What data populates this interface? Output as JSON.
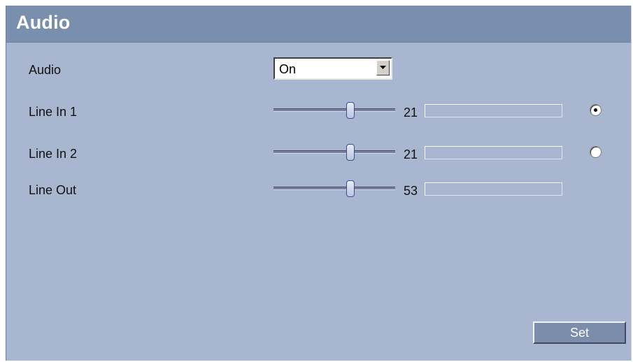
{
  "header": {
    "title": "Audio"
  },
  "rows": {
    "audio": {
      "label": "Audio",
      "selected": "On"
    },
    "line_in_1": {
      "label": "Line In 1",
      "value": "21",
      "level_fraction": 0.64,
      "meter_fraction": 0,
      "radio_selected": true
    },
    "line_in_2": {
      "label": "Line In 2",
      "value": "21",
      "level_fraction": 0.64,
      "meter_fraction": 0,
      "radio_selected": false
    },
    "line_out": {
      "label": "Line Out",
      "value": "53",
      "level_fraction": 0.64,
      "meter_fraction": 0
    }
  },
  "actions": {
    "set_label": "Set"
  },
  "colors": {
    "panel": "#a8b6cf",
    "header": "#7a8fae",
    "button": "#7c8cab"
  }
}
